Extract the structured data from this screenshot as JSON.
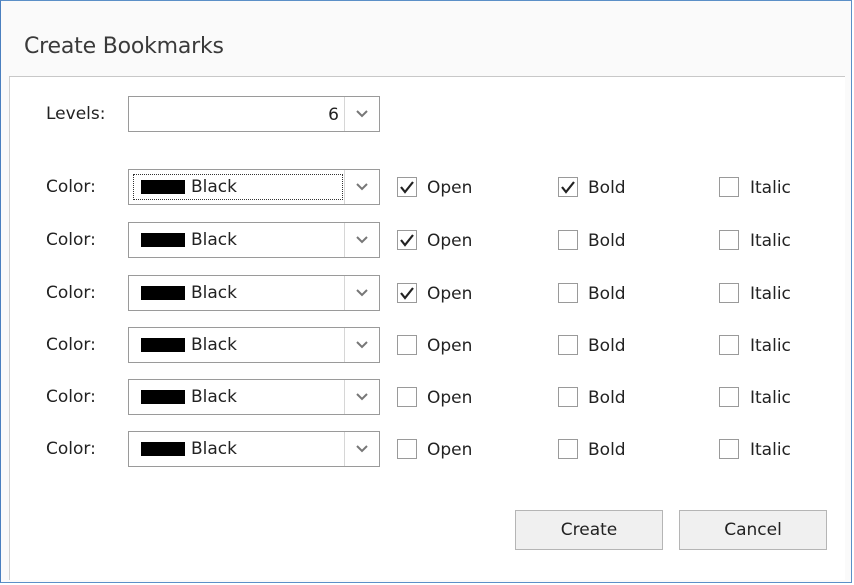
{
  "dialog": {
    "title": "Create Bookmarks",
    "levels_label": "Levels:",
    "levels_value": "6",
    "rows": [
      {
        "color_label": "Color:",
        "color": "Black",
        "open": true,
        "bold": true,
        "italic": false,
        "open_label": "Open",
        "bold_label": "Bold",
        "italic_label": "Italic"
      },
      {
        "color_label": "Color:",
        "color": "Black",
        "open": true,
        "bold": false,
        "italic": false,
        "open_label": "Open",
        "bold_label": "Bold",
        "italic_label": "Italic"
      },
      {
        "color_label": "Color:",
        "color": "Black",
        "open": true,
        "bold": false,
        "italic": false,
        "open_label": "Open",
        "bold_label": "Bold",
        "italic_label": "Italic"
      },
      {
        "color_label": "Color:",
        "color": "Black",
        "open": false,
        "bold": false,
        "italic": false,
        "open_label": "Open",
        "bold_label": "Bold",
        "italic_label": "Italic"
      },
      {
        "color_label": "Color:",
        "color": "Black",
        "open": false,
        "bold": false,
        "italic": false,
        "open_label": "Open",
        "bold_label": "Bold",
        "italic_label": "Italic"
      },
      {
        "color_label": "Color:",
        "color": "Black",
        "open": false,
        "bold": false,
        "italic": false,
        "open_label": "Open",
        "bold_label": "Bold",
        "italic_label": "Italic"
      }
    ],
    "create_label": "Create",
    "cancel_label": "Cancel"
  },
  "colors": {
    "swatch": "#000000",
    "border_accent": "#5b8fc7"
  },
  "icons": {
    "dropdown": "chevron-down-icon",
    "check": "checkmark-icon"
  }
}
